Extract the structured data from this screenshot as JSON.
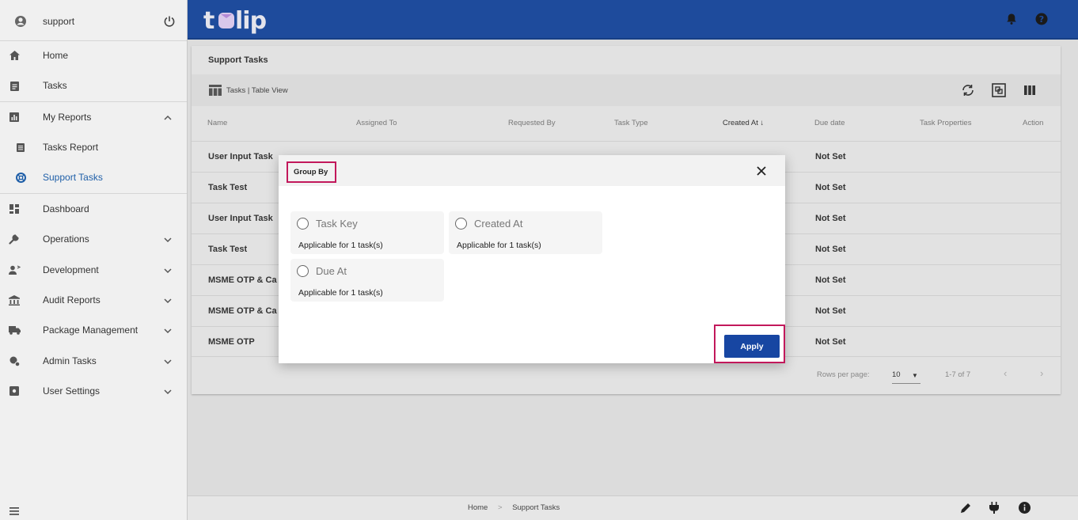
{
  "sidebar": {
    "user": "support",
    "items": [
      {
        "label": "Home",
        "icon": "home-icon"
      },
      {
        "label": "Tasks",
        "icon": "clipboard-icon"
      },
      {
        "label": "My Reports",
        "icon": "report-icon"
      },
      {
        "label": "Tasks Report",
        "icon": "document-icon"
      },
      {
        "label": "Support Tasks",
        "icon": "support-icon"
      },
      {
        "label": "Dashboard",
        "icon": "dashboard-icon"
      },
      {
        "label": "Operations",
        "icon": "wrench-icon"
      },
      {
        "label": "Development",
        "icon": "developer-icon"
      },
      {
        "label": "Audit Reports",
        "icon": "bank-icon"
      },
      {
        "label": "Package Management",
        "icon": "truck-icon"
      },
      {
        "label": "Admin Tasks",
        "icon": "admin-icon"
      },
      {
        "label": "User Settings",
        "icon": "settings-icon"
      }
    ]
  },
  "header": {
    "logo": "tulip"
  },
  "card": {
    "title": "Support Tasks",
    "view_label": "Tasks | Table View",
    "columns": [
      "Name",
      "Assigned To",
      "Requested By",
      "Task Type",
      "Created At",
      "Due date",
      "Task Properties",
      "Action"
    ],
    "rows": [
      {
        "name": "User Input Task",
        "due": "Not Set"
      },
      {
        "name": "Task Test",
        "due": "Not Set"
      },
      {
        "name": "User Input Task",
        "due": "Not Set"
      },
      {
        "name": "Task Test",
        "due": "Not Set"
      },
      {
        "name": "MSME OTP & Ca",
        "due": "Not Set"
      },
      {
        "name": "MSME OTP & Ca",
        "due": "Not Set"
      },
      {
        "name": "MSME OTP",
        "due": "Not Set"
      }
    ],
    "rows_per_page_label": "Rows per page:",
    "rows_per_page": "10",
    "page_range": "1-7 of 7"
  },
  "footer": {
    "breadcrumb": [
      "Home",
      ">",
      "Support Tasks"
    ]
  },
  "dialog": {
    "title": "Group By",
    "options": [
      {
        "label": "Task Key",
        "sub": "Applicable for 1 task(s)"
      },
      {
        "label": "Created At",
        "sub": "Applicable for 1 task(s)"
      },
      {
        "label": "Due At",
        "sub": "Applicable for 1 task(s)"
      }
    ],
    "apply_label": "Apply"
  },
  "colors": {
    "topbar": "#1e4b9c",
    "accent": "#1746a2",
    "highlight": "#c2185b"
  }
}
